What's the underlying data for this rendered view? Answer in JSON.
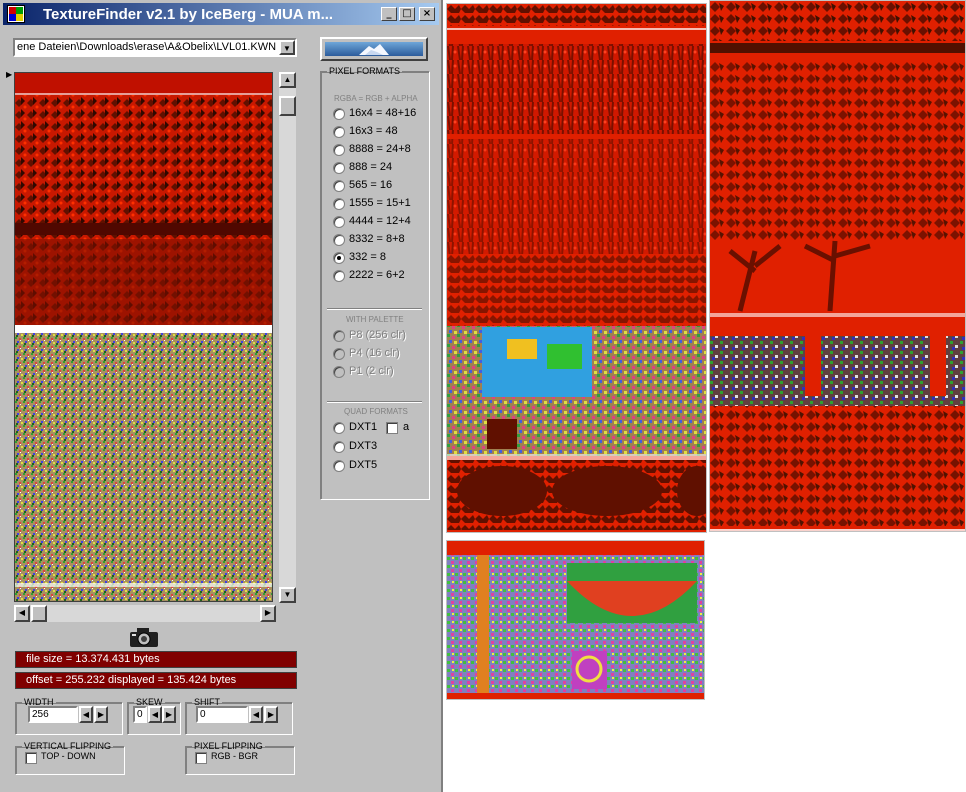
{
  "window": {
    "title": "TextureFinder v2.1 by IceBerg - MUA m...",
    "minimize": "_",
    "maximize": "□",
    "close": "×"
  },
  "path_combo": {
    "value": "ene Dateien\\Downloads\\erase\\A&Obelix\\LVL01.KWN",
    "dropdown_arrow": "▼"
  },
  "pixel_formats": {
    "legend": "PIXEL FORMATS",
    "rgba_label": "RGBA = RGB + ALPHA",
    "options": [
      {
        "label": "16x4 = 48+16",
        "checked": false
      },
      {
        "label": "16x3 = 48",
        "checked": false
      },
      {
        "label": "8888 = 24+8",
        "checked": false
      },
      {
        "label": "888 = 24",
        "checked": false
      },
      {
        "label": "565 = 16",
        "checked": false
      },
      {
        "label": "1555 = 15+1",
        "checked": false
      },
      {
        "label": "4444 = 12+4",
        "checked": false
      },
      {
        "label": "8332 = 8+8",
        "checked": false
      },
      {
        "label": "332 = 8",
        "checked": true
      },
      {
        "label": "2222 = 6+2",
        "checked": false
      }
    ],
    "palette_label": "WITH PALETTE",
    "palette_options": [
      {
        "label": "P8  (256 clr)"
      },
      {
        "label": "P4  (16 clr)"
      },
      {
        "label": "P1  (2 clr)"
      }
    ],
    "quad_label": "QUAD FORMATS",
    "quad_options": [
      {
        "label": "DXT1"
      },
      {
        "label": "DXT3"
      },
      {
        "label": "DXT5"
      }
    ],
    "alpha_check_label": "a"
  },
  "info": {
    "file_size": "file size = 13.374.431 bytes",
    "offset": "offset = 255.232   displayed = 135.424 bytes"
  },
  "dimensions": {
    "width_legend": "WIDTH",
    "width_value": "256",
    "skew_legend": "SKEW",
    "skew_value": "0",
    "shift_legend": "SHIFT",
    "shift_value": "0"
  },
  "flipping": {
    "vertical_legend": "VERTICAL FLIPPING",
    "vertical_label": "TOP - DOWN",
    "pixel_legend": "PIXEL FLIPPING",
    "pixel_label": "RGB  -  BGR"
  },
  "scroll": {
    "up": "▲",
    "down": "▼",
    "left": "◀",
    "right": "▶",
    "marker": "▶"
  },
  "colors": {
    "titlebar_start": "#0a246a",
    "titlebar_end": "#a6caf0",
    "info_bg": "#800000",
    "texture_red": "#e02000"
  },
  "icons": {
    "app": "texturefinder-app-icon",
    "camera": "camera-icon",
    "logo": "iceberg-logo"
  }
}
